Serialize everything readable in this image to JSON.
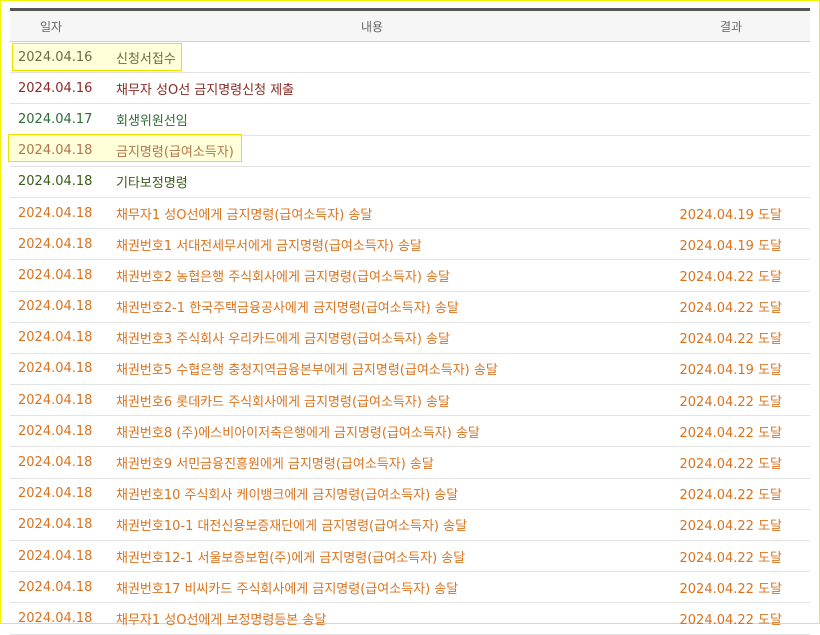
{
  "colors": {
    "black": "#1a1a1a",
    "maroon": "#8b2a25",
    "green": "#2f6b35",
    "olive": "#3c5a1a",
    "orange": "#d9731f",
    "highlight_border": "#f0e000"
  },
  "header": {
    "date": "일자",
    "content": "내용",
    "result": "결과"
  },
  "rows": [
    {
      "date": "2024.04.16",
      "content": "신청서접수",
      "result": "",
      "color": "black"
    },
    {
      "date": "2024.04.16",
      "content": "채무자 성O선 금지명령신청 제출",
      "result": "",
      "color": "maroon"
    },
    {
      "date": "2024.04.17",
      "content": "회생위원선임",
      "result": "",
      "color": "green"
    },
    {
      "date": "2024.04.18",
      "content": "금지명령(급여소득자)",
      "result": "",
      "color": "maroon"
    },
    {
      "date": "2024.04.18",
      "content": "기타보정명령",
      "result": "",
      "color": "olive"
    },
    {
      "date": "2024.04.18",
      "content": "채무자1 성O선에게 금지명령(급여소득자) 송달",
      "result": "2024.04.19 도달",
      "color": "orange"
    },
    {
      "date": "2024.04.18",
      "content": "채권번호1 서대전세무서에게 금지명령(급여소득자) 송달",
      "result": "2024.04.19 도달",
      "color": "orange"
    },
    {
      "date": "2024.04.18",
      "content": "채권번호2 농협은행 주식회사에게 금지명령(급여소득자) 송달",
      "result": "2024.04.22 도달",
      "color": "orange"
    },
    {
      "date": "2024.04.18",
      "content": "채권번호2-1 한국주택금융공사에게 금지명령(급여소득자) 송달",
      "result": "2024.04.22 도달",
      "color": "orange"
    },
    {
      "date": "2024.04.18",
      "content": "채권번호3 주식회사 우리카드에게 금지명령(급여소득자) 송달",
      "result": "2024.04.22 도달",
      "color": "orange"
    },
    {
      "date": "2024.04.18",
      "content": "채권번호5 수협은행 충청지역금융본부에게 금지명령(급여소득자) 송달",
      "result": "2024.04.19 도달",
      "color": "orange"
    },
    {
      "date": "2024.04.18",
      "content": "채권번호6 롯데카드 주식회사에게 금지명령(급여소득자) 송달",
      "result": "2024.04.22 도달",
      "color": "orange"
    },
    {
      "date": "2024.04.18",
      "content": "채권번호8 (주)에스비아이저축은행에게 금지명령(급여소득자) 송달",
      "result": "2024.04.22 도달",
      "color": "orange"
    },
    {
      "date": "2024.04.18",
      "content": "채권번호9 서민금융진흥원에게 금지명령(급여소득자) 송달",
      "result": "2024.04.22 도달",
      "color": "orange"
    },
    {
      "date": "2024.04.18",
      "content": "채권번호10 주식회사 케이뱅크에게 금지명령(급여소득자) 송달",
      "result": "2024.04.22 도달",
      "color": "orange"
    },
    {
      "date": "2024.04.18",
      "content": "채권번호10-1 대전신용보증재단에게 금지명령(급여소득자) 송달",
      "result": "2024.04.22 도달",
      "color": "orange"
    },
    {
      "date": "2024.04.18",
      "content": "채권번호12-1 서울보증보험(주)에게 금지명령(급여소득자) 송달",
      "result": "2024.04.22 도달",
      "color": "orange"
    },
    {
      "date": "2024.04.18",
      "content": "채권번호17 비씨카드 주식회사에게 금지명령(급여소득자) 송달",
      "result": "2024.04.22 도달",
      "color": "orange"
    },
    {
      "date": "2024.04.18",
      "content": "채무자1 성O선에게 보정명령등본 송달",
      "result": "2024.04.22 도달",
      "color": "orange"
    }
  ]
}
